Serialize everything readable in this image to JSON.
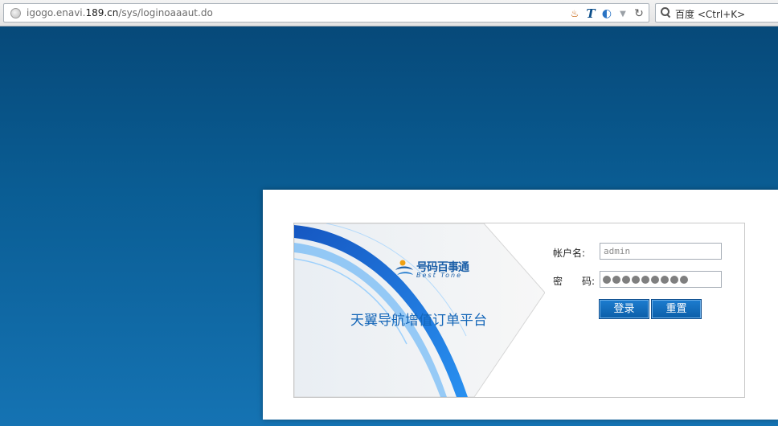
{
  "browser": {
    "url_domain_prefix": "igogo.enavi.",
    "url_domain_main": "189.cn",
    "url_path": "/sys/loginoaaaut.do",
    "search_placeholder": "百度 <Ctrl+K>"
  },
  "banner": {
    "logo_text_cn": "号码百事通",
    "logo_text_en": "Best Tone",
    "title": "天翼导航增值订单平台"
  },
  "form": {
    "username_label": "帐户名:",
    "username_value": "admin",
    "password_label": "密　　码:",
    "password_mask_count": 9,
    "login_button": "登录",
    "reset_button": "重置"
  },
  "colors": {
    "background_top": "#064675",
    "background_bottom": "#1573b3",
    "button": "#0b5ea8",
    "title": "#1466b8"
  }
}
